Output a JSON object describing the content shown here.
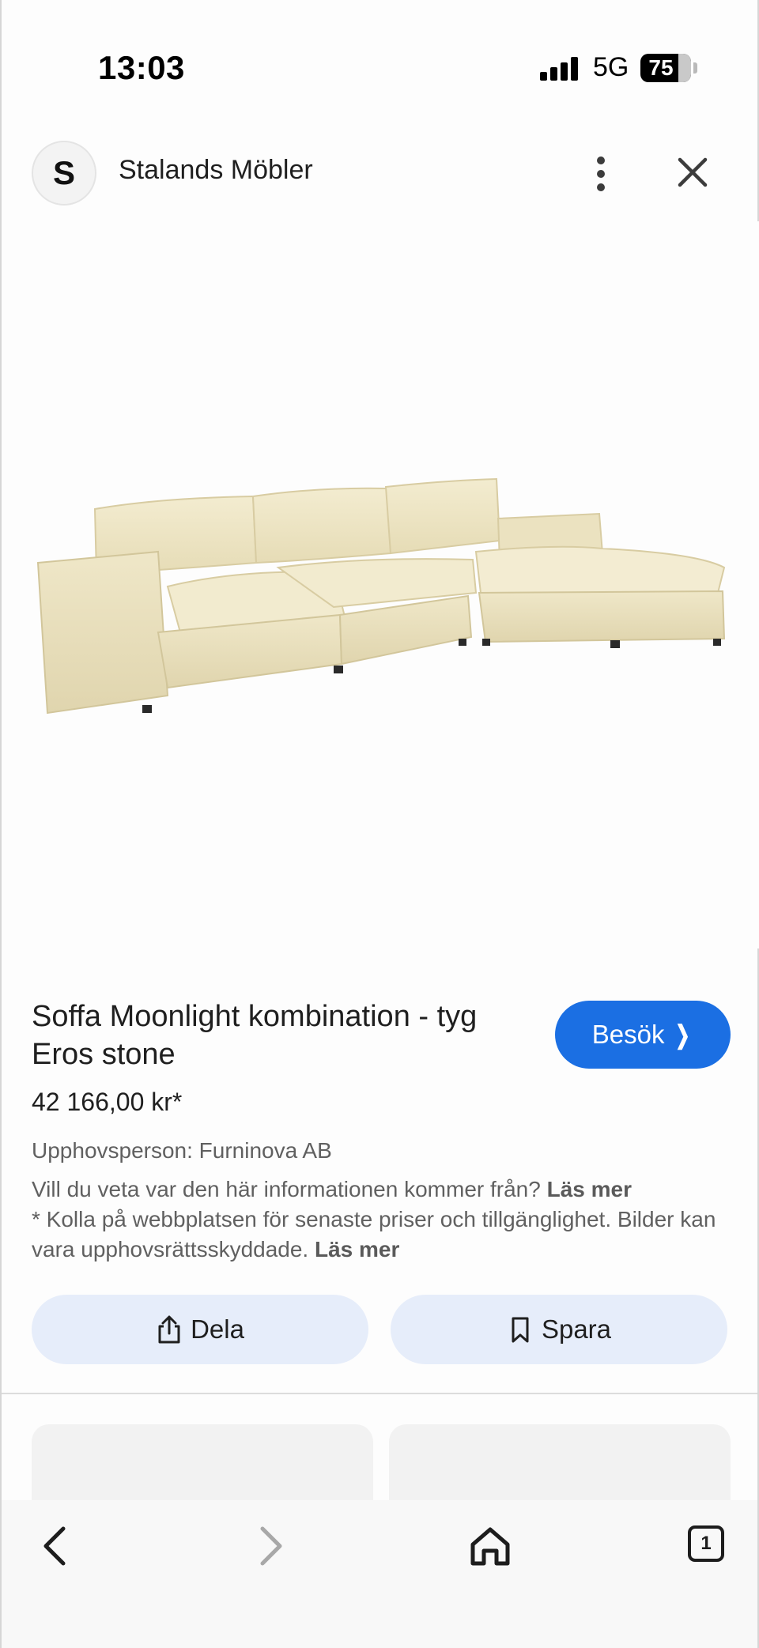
{
  "status_bar": {
    "time": "13:03",
    "network": "5G",
    "battery_level": "75",
    "battery_fraction": 0.75
  },
  "site": {
    "avatar_letter": "S",
    "name": "Stalands Möbler",
    "icons": {
      "more": "more-vert-icon",
      "close": "close-icon"
    }
  },
  "product": {
    "image_icon": "sofa-image",
    "title": "Soffa Moonlight kombination - tyg Eros stone",
    "price": "42 166,00 kr*",
    "visit_label": "Besök",
    "credit": "Upphovsperson: Furninova AB",
    "info_question": "Vill du veta var den här informationen kommer från?",
    "read_more": "Läs mer",
    "notice": "* Kolla på webbplatsen för senaste priser och tillgänglighet. Bilder kan vara upphovsrättsskyddade.",
    "read_more_2": "Läs mer"
  },
  "actions": {
    "share_label": "Dela",
    "save_label": "Spara",
    "share_icon": "share-icon",
    "save_icon": "bookmark-icon"
  },
  "toolbar": {
    "tabs_count": "1",
    "icons": [
      "back-icon",
      "forward-icon",
      "home-icon",
      "tabs-icon"
    ]
  },
  "colors": {
    "accent": "#1b6fe3",
    "action_bg": "#e6edfa",
    "sofa": "#efe7c8"
  }
}
